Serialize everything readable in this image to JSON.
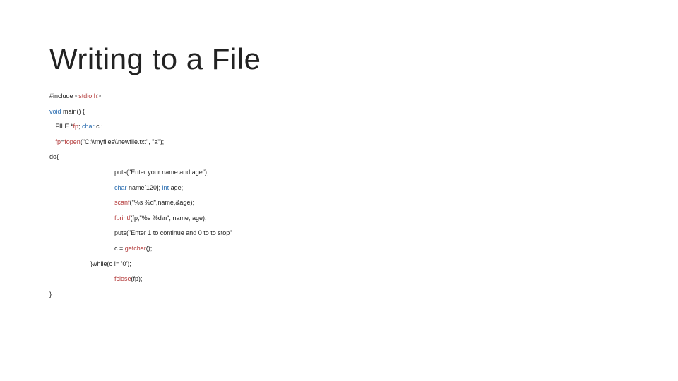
{
  "title": "Writing to a File",
  "code": {
    "l1a": "#include <",
    "l1b": "stdio.h",
    "l1c": ">",
    "l2a": "void",
    "l2b": " main() {",
    "l3a": " FILE *",
    "l3b": "fp",
    "l3c": "; ",
    "l3d": "char",
    "l3e": " c ;",
    "l4a": " fp",
    "l4b": "=",
    "l4c": "fopen",
    "l4d": "(\"C:\\\\myfiles\\\\newfile.txt\", \"a\");",
    "l5": "do{",
    "l6": "puts(\"Enter your name and age\");",
    "l7a": "char",
    "l7b": " name[120]; ",
    "l7c": "int",
    "l7d": " age;",
    "l8a": "scanf",
    "l8b": "(\"%s %d\",name,&age);",
    "l9a": "fprintf",
    "l9b": "(fp,\"%s %d\\n\", name, age);",
    "l10": "puts(\"Enter 1 to continue and 0 to to stop\"",
    "l11a": "c = ",
    "l11b": "getchar",
    "l11c": "();",
    "l12": "}while(c != '0');",
    "l13a": "fclose",
    "l13b": "(fp);",
    "l14": "}"
  }
}
